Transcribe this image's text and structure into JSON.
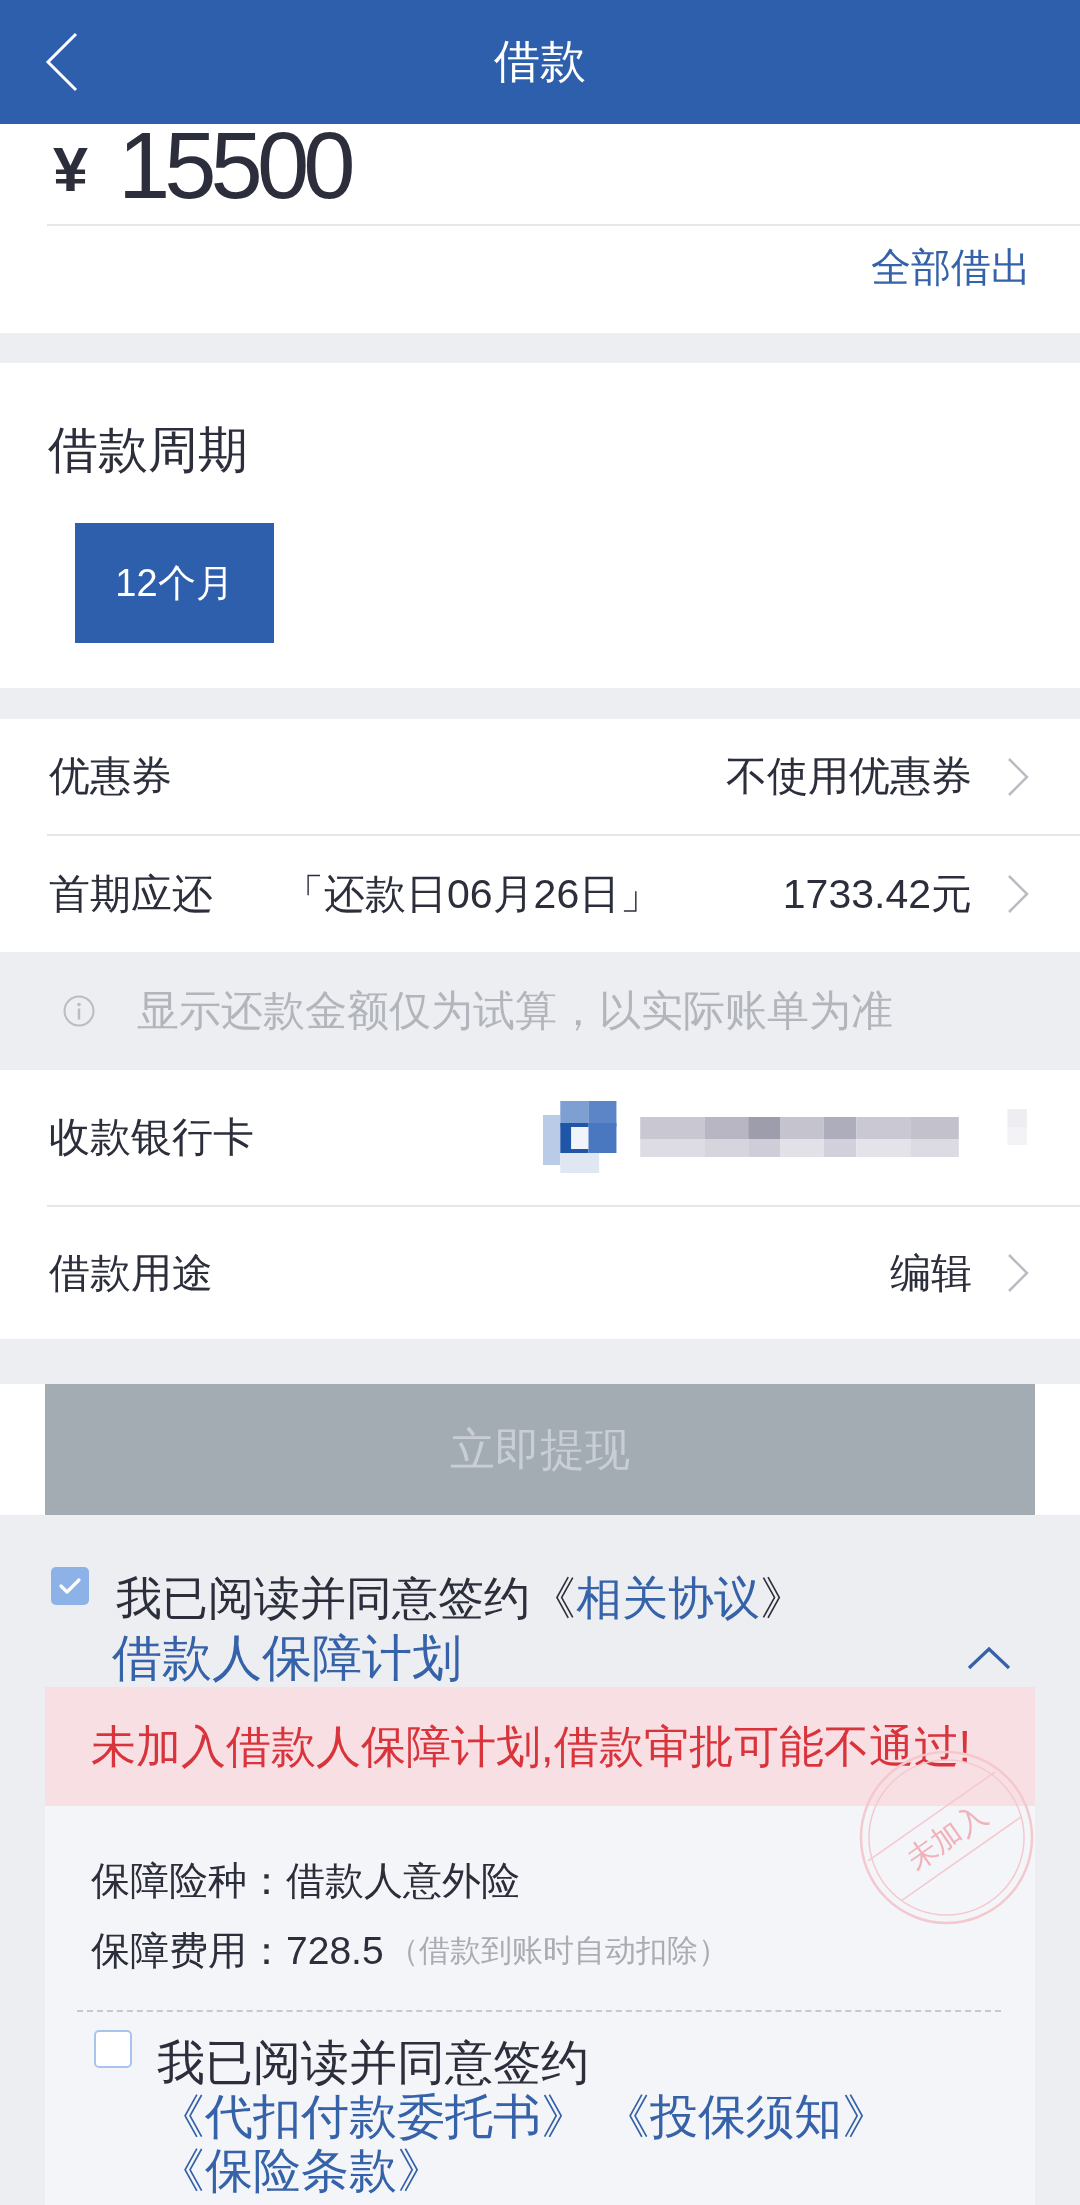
{
  "header": {
    "title": "借款"
  },
  "amount": {
    "currency": "¥",
    "value": "15500",
    "borrow_all": "全部借出"
  },
  "period": {
    "title": "借款周期",
    "options": [
      {
        "label": "12个月",
        "selected": true
      }
    ]
  },
  "fee_rows": [
    {
      "kind": "nav",
      "label": "优惠券",
      "value": "不使用优惠券"
    },
    {
      "kind": "nav",
      "label": "首期应还",
      "note": "「还款日06月26日」",
      "value": "1733.42元"
    }
  ],
  "notice": {
    "text": "显示还款金额仅为试算，以实际账单为准"
  },
  "detail_rows": [
    {
      "kind": "masked",
      "label": "收款银行卡"
    },
    {
      "kind": "nav",
      "label": "借款用途",
      "value": "编辑"
    }
  ],
  "submit": {
    "label": "立即提现",
    "disabled": true
  },
  "agreement": {
    "checked": true,
    "prefix": "我已阅读并同意签约《",
    "link": "相关协议",
    "suffix": "》"
  },
  "protection": {
    "title": "借款人保障计划",
    "expanded": true,
    "warning": "未加入借款人保障计划,借款审批可能不通过!",
    "stamp": "未加入",
    "details": [
      {
        "text": "保障险种：借款人意外险"
      },
      {
        "text": "保障费用：728.5",
        "note": "（借款到账时自动扣除）"
      }
    ],
    "consent": {
      "checked": false,
      "text": "我已阅读并同意签约",
      "links": [
        "《代扣付款委托书》",
        "《投保须知》",
        "《保险条款》"
      ]
    }
  }
}
